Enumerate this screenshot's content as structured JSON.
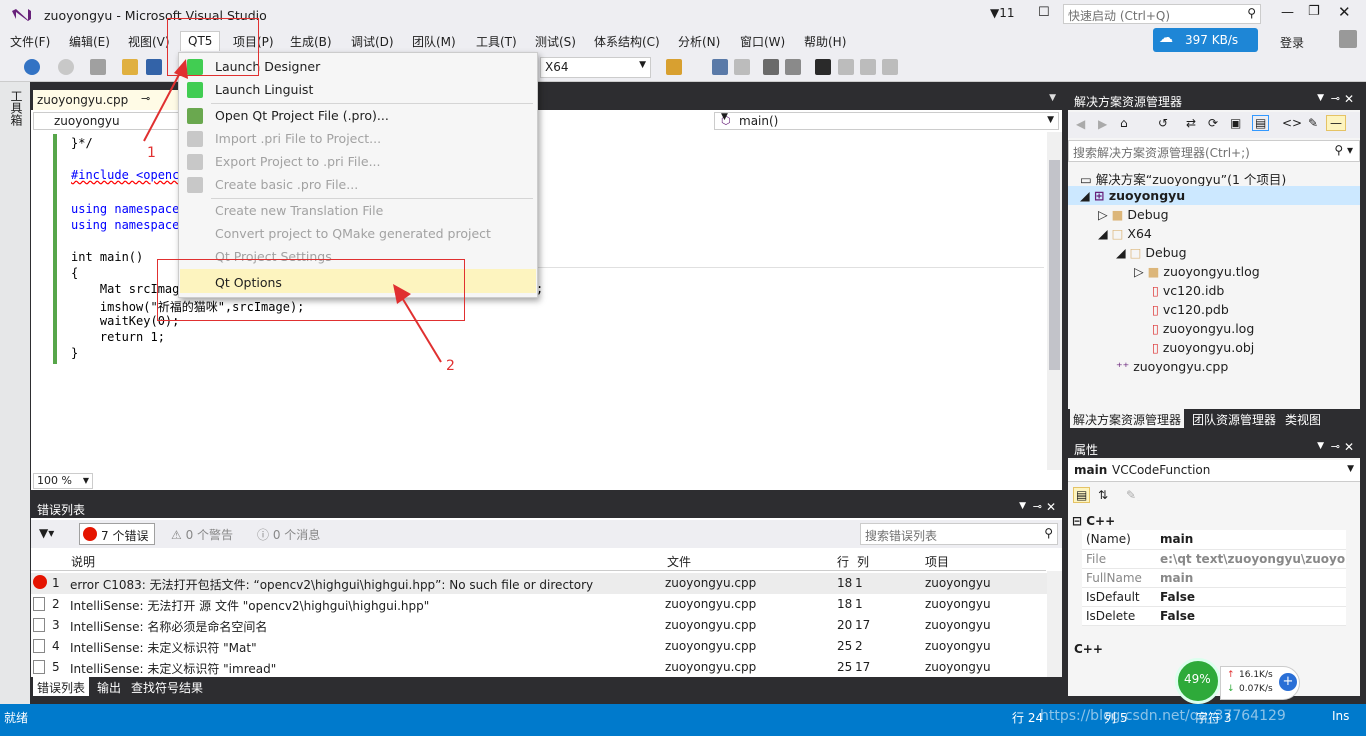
{
  "window": {
    "title": "zuoyongyu - Microsoft Visual Studio",
    "notif_count": "11",
    "quick_launch_placeholder": "快速启动 (Ctrl+Q)",
    "speed": "397 KB/s",
    "login": "登录"
  },
  "menubar": [
    "文件(F)",
    "编辑(E)",
    "视图(V)",
    "QT5",
    "项目(P)",
    "生成(B)",
    "调试(D)",
    "团队(M)",
    "工具(T)",
    "测试(S)",
    "体系结构(C)",
    "分析(N)",
    "窗口(W)",
    "帮助(H)"
  ],
  "toolbar": {
    "platform": "X64"
  },
  "left_strip": "工具箱",
  "editor": {
    "tab": "zuoyongyu.cpp",
    "scope": "zuoyongyu",
    "function": "main()",
    "zoom": "100 %",
    "lines": [
      "}*/",
      "#include <opencv",
      "using namespace",
      "using namespace",
      "int main()",
      "{",
      "    Mat srcImage",
      "    imshow(\"祈福的猫咪\",srcImage);",
      "    waitKey(0);",
      "    return 1;",
      "}"
    ],
    "line_tail": ";"
  },
  "qt_menu": [
    {
      "label": "Launch Designer",
      "enabled": true
    },
    {
      "label": "Launch Linguist",
      "enabled": true
    },
    {
      "label": "Open Qt Project File (.pro)...",
      "enabled": true
    },
    {
      "label": "Import .pri File to Project...",
      "enabled": false
    },
    {
      "label": "Export Project to .pri File...",
      "enabled": false
    },
    {
      "label": "Create basic .pro File...",
      "enabled": false
    },
    {
      "label": "Create new Translation File",
      "enabled": false
    },
    {
      "label": "Convert project to QMake generated project",
      "enabled": false
    },
    {
      "label": "Qt Project Settings",
      "enabled": false
    },
    {
      "label": "Qt Options",
      "enabled": true
    }
  ],
  "annotations": {
    "n1": "1",
    "n2": "2"
  },
  "errors": {
    "title": "错误列表",
    "errors_btn": "7 个错误",
    "warnings_btn": "0 个警告",
    "messages_btn": "0 个消息",
    "search_placeholder": "搜索错误列表",
    "columns": [
      "说明",
      "文件",
      "行",
      "列",
      "项目"
    ],
    "rows": [
      {
        "n": "1",
        "desc": "error C1083: 无法打开包括文件: “opencv2\\highgui\\highgui.hpp”: No such file or directory",
        "file": "zuoyongyu.cpp",
        "line": "18",
        "col": "1",
        "proj": "zuoyongyu"
      },
      {
        "n": "2",
        "desc": "IntelliSense: 无法打开 源 文件 \"opencv2\\highgui\\highgui.hpp\"",
        "file": "zuoyongyu.cpp",
        "line": "18",
        "col": "1",
        "proj": "zuoyongyu"
      },
      {
        "n": "3",
        "desc": "IntelliSense: 名称必须是命名空间名",
        "file": "zuoyongyu.cpp",
        "line": "20",
        "col": "17",
        "proj": "zuoyongyu"
      },
      {
        "n": "4",
        "desc": "IntelliSense: 未定义标识符 \"Mat\"",
        "file": "zuoyongyu.cpp",
        "line": "25",
        "col": "2",
        "proj": "zuoyongyu"
      },
      {
        "n": "5",
        "desc": "IntelliSense: 未定义标识符 \"imread\"",
        "file": "zuoyongyu.cpp",
        "line": "25",
        "col": "17",
        "proj": "zuoyongyu"
      }
    ],
    "bottom_tabs": [
      "错误列表",
      "输出",
      "查找符号结果"
    ]
  },
  "solution": {
    "title": "解决方案资源管理器",
    "search_placeholder": "搜索解决方案资源管理器(Ctrl+;)",
    "tree": [
      "解决方案“zuoyongyu”(1 个项目)",
      "zuoyongyu",
      "Debug",
      "X64",
      "Debug",
      "zuoyongyu.tlog",
      "vc120.idb",
      "vc120.pdb",
      "zuoyongyu.log",
      "zuoyongyu.obj",
      "zuoyongyu.cpp"
    ],
    "tabs": [
      "解决方案资源管理器",
      "团队资源管理器",
      "类视图"
    ]
  },
  "properties": {
    "title": "属性",
    "object": "main",
    "object_type": "VCCodeFunction",
    "category": "C++",
    "rows": [
      {
        "k": "(Name)",
        "v": "main"
      },
      {
        "k": "File",
        "v": "e:\\qt text\\zuoyongyu\\zuoyon"
      },
      {
        "k": "FullName",
        "v": "main"
      },
      {
        "k": "IsDefault",
        "v": "False"
      },
      {
        "k": "IsDelete",
        "v": "False"
      }
    ],
    "footer": "C++",
    "cpu": "49%",
    "net_up": "16.1K/s",
    "net_down": "0.07K/s"
  },
  "status": {
    "ready": "就绪",
    "line": "行 24",
    "col": "列 5",
    "char": "字符 3",
    "ins": "Ins",
    "watermark": "https://blog.csdn.net/qq_37764129"
  }
}
